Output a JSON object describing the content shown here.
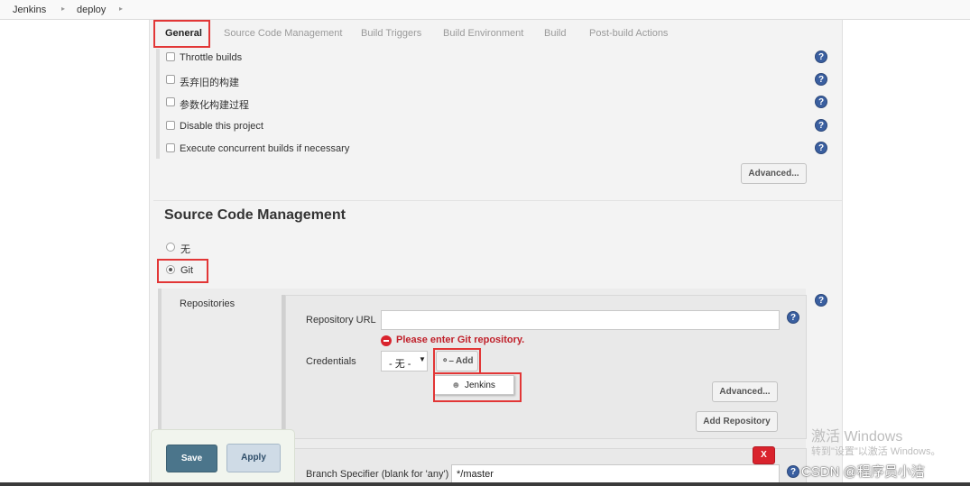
{
  "breadcrumb": {
    "items": [
      "Jenkins",
      "deploy"
    ]
  },
  "tabs": [
    "General",
    "Source Code Management",
    "Build Triggers",
    "Build Environment",
    "Build",
    "Post-build Actions"
  ],
  "general": {
    "options": [
      "Throttle builds",
      "丢弃旧的构建",
      "参数化构建过程",
      "Disable this project",
      "Execute concurrent builds if necessary"
    ],
    "advanced_label": "Advanced..."
  },
  "scm": {
    "title": "Source Code Management",
    "none_label": "无",
    "git_label": "Git",
    "repositories_label": "Repositories",
    "repo_url_label": "Repository URL",
    "repo_url_value": "",
    "error_text": "Please enter Git repository.",
    "credentials_label": "Credentials",
    "credentials_selected": "- 无 -",
    "add_label": "Add",
    "add_menu_item": "Jenkins",
    "advanced_label": "Advanced...",
    "add_repository_label": "Add Repository",
    "delete_label": "X",
    "branch_label": "Branch Specifier (blank for 'any')",
    "branch_value": "*/master"
  },
  "actions": {
    "save_label": "Save",
    "apply_label": "Apply"
  },
  "help_glyph": "?",
  "icons": {
    "help": "help-icon",
    "error": "error-icon",
    "key": "key-icon",
    "jenkins": "jenkins-icon"
  },
  "colors": {
    "highlight": "#e23636",
    "save": "#4b758b",
    "error": "#c0202a",
    "help": "#3a5fa0",
    "delete": "#d9232d"
  },
  "watermark": {
    "line1": "激活 Windows",
    "line2": "转到\"设置\"以激活 Windows。",
    "csdn": "CSDN @程序员小洁"
  }
}
